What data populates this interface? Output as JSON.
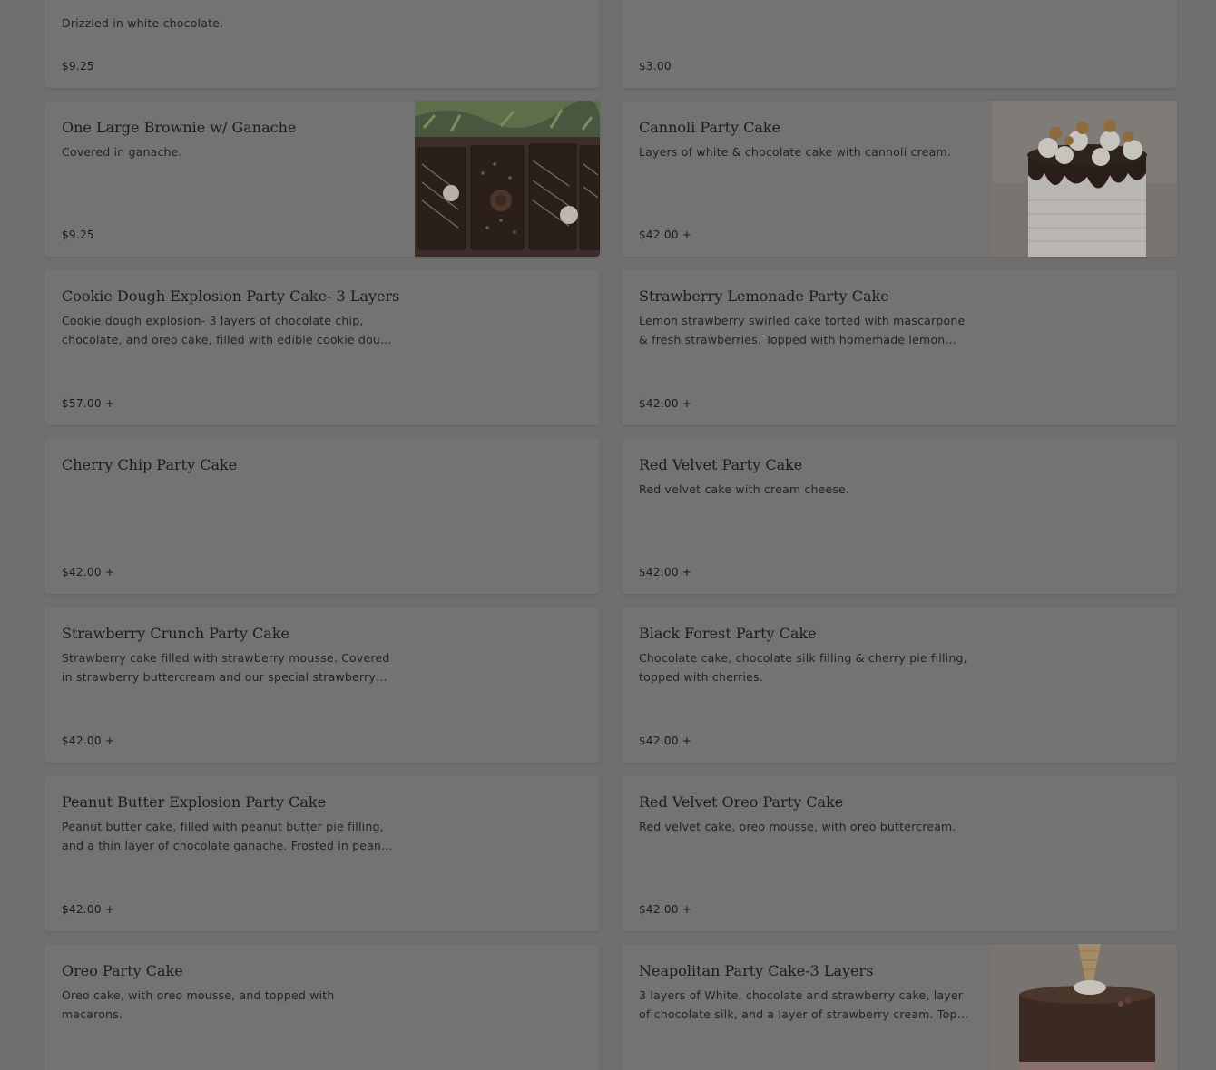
{
  "items": [
    {
      "title": "",
      "desc": "Drizzled in white chocolate.",
      "price": "$9.25"
    },
    {
      "title": "",
      "desc": "",
      "price": "$3.00"
    },
    {
      "title": "One Large Brownie w/ Ganache",
      "desc": "Covered in ganache.",
      "price": "$9.25",
      "image": "brownie-photo"
    },
    {
      "title": "Cannoli Party Cake",
      "desc": "Layers of white & chocolate cake with cannoli cream.",
      "price": "$42.00 +",
      "image": "cannoli-cake-photo"
    },
    {
      "title": "Cookie Dough Explosion Party Cake- 3 Layers",
      "desc": "Cookie dough explosion- 3 layers of chocolate chip, chocolate, and oreo cake, filled with edible cookie dou…",
      "price": "$57.00 +"
    },
    {
      "title": "Strawberry Lemonade Party Cake",
      "desc": "Lemon strawberry swirled cake torted with mascarpone & fresh strawberries. Topped with homemade lemon ba…",
      "price": "$42.00 +"
    },
    {
      "title": "Cherry Chip Party Cake",
      "desc": "",
      "price": "$42.00 +"
    },
    {
      "title": "Red Velvet Party Cake",
      "desc": "Red velvet cake with cream cheese.",
      "price": "$42.00 +"
    },
    {
      "title": "Strawberry Crunch Party Cake",
      "desc": "Strawberry cake filled with strawberry mousse. Covered in strawberry buttercream and our special strawberry c…",
      "price": "$42.00 +"
    },
    {
      "title": "Black Forest Party Cake",
      "desc": "Chocolate cake, chocolate silk filling & cherry pie filling, topped with cherries.",
      "price": "$42.00 +"
    },
    {
      "title": "Peanut Butter Explosion Party Cake",
      "desc": "Peanut butter cake, filled with peanut butter pie filling, and a thin layer of chocolate ganache. Frosted in pean…",
      "price": "$42.00 +"
    },
    {
      "title": "Red Velvet Oreo Party Cake",
      "desc": "Red velvet cake, oreo mousse, with oreo buttercream.",
      "price": "$42.00 +"
    },
    {
      "title": "Oreo Party Cake",
      "desc": "Oreo cake, with oreo mousse, and topped with macarons.",
      "price": "$"
    },
    {
      "title": "Neapolitan Party Cake-3 Layers",
      "desc": "3 layers of White, chocolate and strawberry cake, layer of chocolate silk, and a layer of strawberry cream. Top…",
      "price": "$",
      "image": "neapolitan-cake-photo"
    }
  ]
}
